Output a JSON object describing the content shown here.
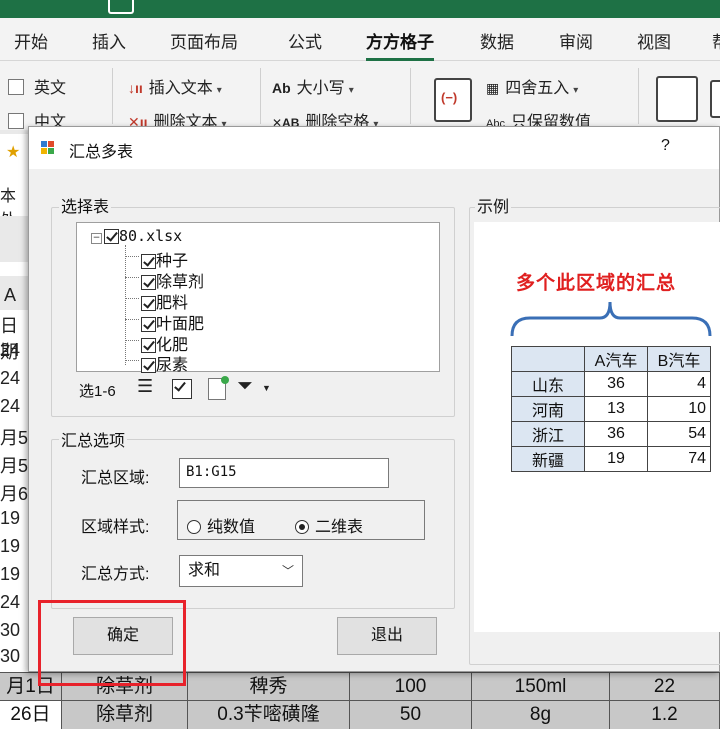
{
  "ribbon": {
    "tabs": [
      "开始",
      "插入",
      "页面布局",
      "公式",
      "方方格子",
      "数据",
      "审阅",
      "视图",
      "帮"
    ],
    "active_tab": "方方格子",
    "checkbox_english": "英文",
    "checkbox_chinese": "中文",
    "insert_text": "插入文本",
    "delete_text": "删除文本",
    "case": "大小写",
    "delete_space": "删除空格",
    "round": "四舍五入",
    "keep_value": "只保留数值",
    "side_label": "本处",
    "accent_color": "#1e7145"
  },
  "sheet": {
    "col_header": "A",
    "left_column": [
      "日期",
      "24",
      "24",
      "24",
      "月5",
      "月5",
      "月6",
      "19",
      "19",
      "19",
      "24",
      "30",
      "30"
    ],
    "bottom_rows": [
      [
        "月1日",
        "除草剂",
        "稗秀",
        "100",
        "150ml",
        "22"
      ],
      [
        "26日",
        "除草剂",
        "0.3苄嘧磺隆",
        "50",
        "8g",
        "1.2"
      ]
    ]
  },
  "dialog": {
    "title": "汇总多表",
    "help": "?",
    "select_group": "选择表",
    "tree_root": "80.xlsx",
    "tree_items": [
      "种子",
      "除草剂",
      "肥料",
      "叶面肥",
      "化肥",
      "尿素"
    ],
    "selection_info": "选1-6",
    "options_group": "汇总选项",
    "region_label": "汇总区域:",
    "region_value": "B1:G15",
    "style_label": "区域样式:",
    "style_option_1": "纯数值",
    "style_option_2": "二维表",
    "selected_style": "二维表",
    "method_label": "汇总方式:",
    "method_value": "求和",
    "ok_button": "确定",
    "exit_button": "退出",
    "example_group": "示例",
    "example_heading": "多个此区域的汇总",
    "example_table": {
      "headers": [
        "",
        "A汽车",
        "B汽车"
      ],
      "rows": [
        [
          "山东",
          "36",
          "4"
        ],
        [
          "河南",
          "13",
          "10"
        ],
        [
          "浙江",
          "36",
          "54"
        ],
        [
          "新疆",
          "19",
          "74"
        ]
      ]
    },
    "highlight_color": "#e8222b"
  }
}
